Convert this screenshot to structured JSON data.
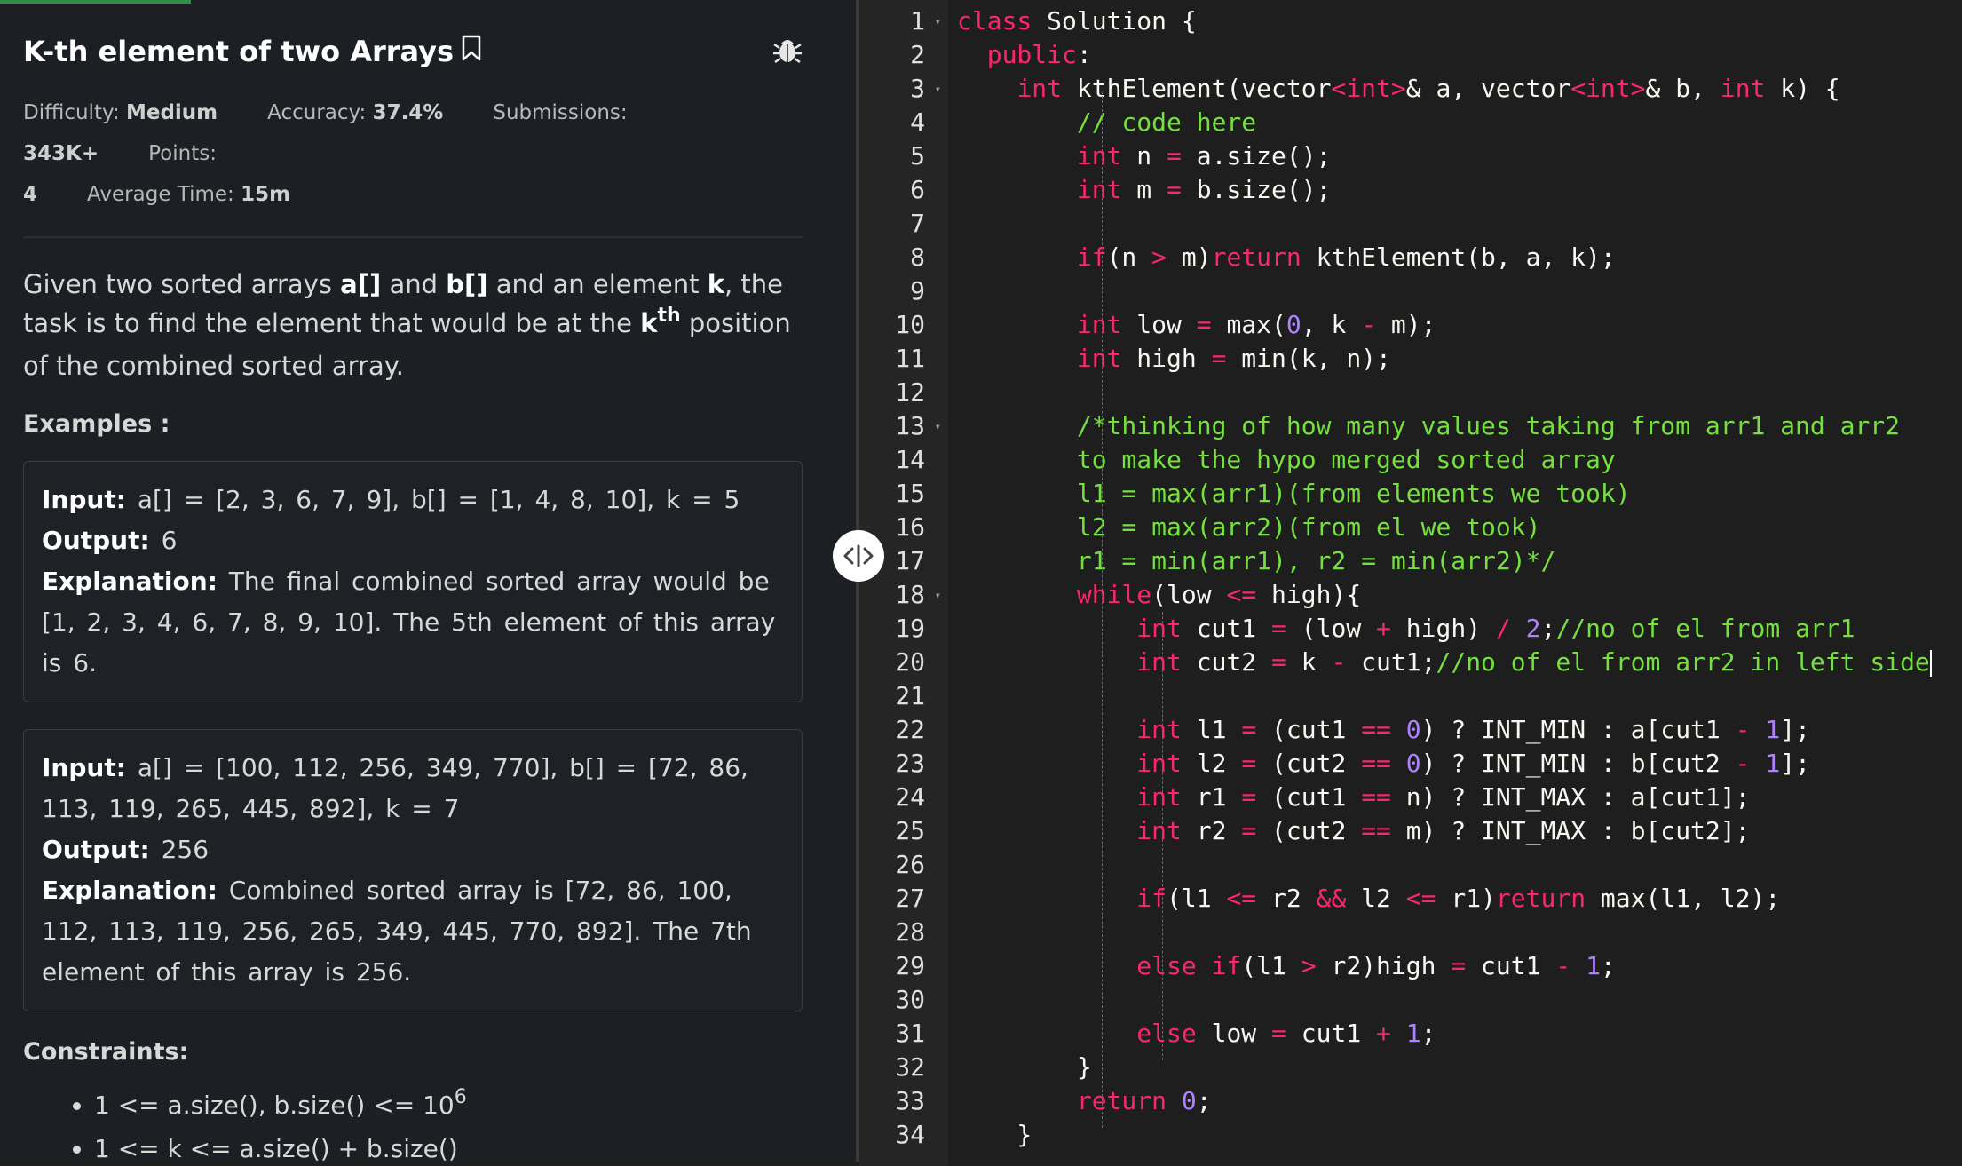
{
  "problem": {
    "title": "K-th element of two Arrays",
    "meta": {
      "difficulty_label": "Difficulty:",
      "difficulty": "Medium",
      "accuracy_label": "Accuracy:",
      "accuracy": "37.4%",
      "submissions_label": "Submissions:",
      "submissions": "343K+",
      "points_label": "Points:",
      "points": "4",
      "avg_time_label": "Average Time:",
      "avg_time": "15m"
    },
    "description": {
      "p1": "Given two sorted arrays ",
      "a": "a[]",
      "p2": " and ",
      "b": "b[]",
      "p3": " and an element ",
      "k": "k",
      "p4": ", the task is to find the element that would be at the ",
      "k2": "k",
      "sup": "th",
      "p5": " position of the combined sorted array."
    },
    "examples_heading": "Examples :",
    "examples": [
      {
        "input_label": "Input:",
        "input": "a[] = [2, 3, 6, 7, 9], b[] = [1, 4, 8, 10], k = 5",
        "output_label": "Output:",
        "output": "6",
        "explanation_label": "Explanation:",
        "explanation": "The final combined sorted array would be [1, 2, 3, 4, 6, 7, 8, 9, 10]. The 5th element of this array is 6."
      },
      {
        "input_label": "Input:",
        "input": "a[] = [100, 112, 256, 349, 770], b[] = [72, 86, 113, 119, 265, 445, 892], k = 7",
        "output_label": "Output:",
        "output": "256",
        "explanation_label": "Explanation:",
        "explanation": "Combined sorted array is [72, 86, 100, 112, 113, 119, 256, 265, 349, 445, 770, 892]. The 7th element of this array is 256."
      }
    ],
    "constraints_heading": "Constraints:",
    "constraints": [
      {
        "text": "1 <= a.size(), b.size() <= 10",
        "sup": "6"
      },
      {
        "text": "1 <= k <= a.size() + b.size()",
        "sup": ""
      }
    ]
  },
  "icons": {
    "bookmark": "bookmark-icon",
    "bug": "bug-icon",
    "splitter": "resize-handle-icon"
  },
  "colors": {
    "keyword": "#f92672",
    "number": "#ae81ff",
    "comment": "#75e03e",
    "progress": "#2f8d46"
  },
  "editor": {
    "fold_lines": [
      1,
      3,
      13,
      18
    ],
    "lines": [
      [
        [
          "k",
          "class"
        ],
        [
          "p",
          " Solution {"
        ]
      ],
      [
        [
          "p",
          "  "
        ],
        [
          "k",
          "public"
        ],
        [
          "p",
          ":"
        ]
      ],
      [
        [
          "p",
          "    "
        ],
        [
          "t",
          "int"
        ],
        [
          "p",
          " kthElement(vector"
        ],
        [
          "k",
          "<"
        ],
        [
          "t",
          "int"
        ],
        [
          "k",
          ">"
        ],
        [
          "p",
          "& a, vector"
        ],
        [
          "k",
          "<"
        ],
        [
          "t",
          "int"
        ],
        [
          "k",
          ">"
        ],
        [
          "p",
          "& b, "
        ],
        [
          "t",
          "int"
        ],
        [
          "p",
          " k) {"
        ]
      ],
      [
        [
          "p",
          "        "
        ],
        [
          "c",
          "// code here"
        ]
      ],
      [
        [
          "p",
          "        "
        ],
        [
          "t",
          "int"
        ],
        [
          "p",
          " n "
        ],
        [
          "k",
          "="
        ],
        [
          "p",
          " a.size();"
        ]
      ],
      [
        [
          "p",
          "        "
        ],
        [
          "t",
          "int"
        ],
        [
          "p",
          " m "
        ],
        [
          "k",
          "="
        ],
        [
          "p",
          " b.size();"
        ]
      ],
      [],
      [
        [
          "p",
          "        "
        ],
        [
          "k",
          "if"
        ],
        [
          "p",
          "(n "
        ],
        [
          "k",
          ">"
        ],
        [
          "p",
          " m)"
        ],
        [
          "k",
          "return"
        ],
        [
          "p",
          " kthElement(b, a, k);"
        ]
      ],
      [],
      [
        [
          "p",
          "        "
        ],
        [
          "t",
          "int"
        ],
        [
          "p",
          " low "
        ],
        [
          "k",
          "="
        ],
        [
          "p",
          " max("
        ],
        [
          "n",
          "0"
        ],
        [
          "p",
          ", k "
        ],
        [
          "k",
          "-"
        ],
        [
          "p",
          " m);"
        ]
      ],
      [
        [
          "p",
          "        "
        ],
        [
          "t",
          "int"
        ],
        [
          "p",
          " high "
        ],
        [
          "k",
          "="
        ],
        [
          "p",
          " min(k, n);"
        ]
      ],
      [],
      [
        [
          "p",
          "        "
        ],
        [
          "c",
          "/*thinking of how many values taking from arr1 and arr2"
        ]
      ],
      [
        [
          "p",
          "        "
        ],
        [
          "c",
          "to make the hypo merged sorted array"
        ]
      ],
      [
        [
          "p",
          "        "
        ],
        [
          "c",
          "l1 = max(arr1)(from elements we took)"
        ]
      ],
      [
        [
          "p",
          "        "
        ],
        [
          "c",
          "l2 = max(arr2)(from el we took)"
        ]
      ],
      [
        [
          "p",
          "        "
        ],
        [
          "c",
          "r1 = min(arr1), r2 = min(arr2)*/"
        ]
      ],
      [
        [
          "p",
          "        "
        ],
        [
          "k",
          "while"
        ],
        [
          "p",
          "(low "
        ],
        [
          "k",
          "<="
        ],
        [
          "p",
          " high){"
        ]
      ],
      [
        [
          "p",
          "            "
        ],
        [
          "t",
          "int"
        ],
        [
          "p",
          " cut1 "
        ],
        [
          "k",
          "="
        ],
        [
          "p",
          " (low "
        ],
        [
          "k",
          "+"
        ],
        [
          "p",
          " high) "
        ],
        [
          "k",
          "/"
        ],
        [
          "p",
          " "
        ],
        [
          "n",
          "2"
        ],
        [
          "p",
          ";"
        ],
        [
          "c",
          "//no of el from arr1"
        ]
      ],
      [
        [
          "p",
          "            "
        ],
        [
          "t",
          "int"
        ],
        [
          "p",
          " cut2 "
        ],
        [
          "k",
          "="
        ],
        [
          "p",
          " k "
        ],
        [
          "k",
          "-"
        ],
        [
          "p",
          " cut1;"
        ],
        [
          "c",
          "//no of el from arr2 in left side"
        ]
      ],
      [],
      [
        [
          "p",
          "            "
        ],
        [
          "t",
          "int"
        ],
        [
          "p",
          " l1 "
        ],
        [
          "k",
          "="
        ],
        [
          "p",
          " (cut1 "
        ],
        [
          "k",
          "=="
        ],
        [
          "p",
          " "
        ],
        [
          "n",
          "0"
        ],
        [
          "p",
          ") ? INT_MIN : a[cut1 "
        ],
        [
          "k",
          "-"
        ],
        [
          "p",
          " "
        ],
        [
          "n",
          "1"
        ],
        [
          "p",
          "];"
        ]
      ],
      [
        [
          "p",
          "            "
        ],
        [
          "t",
          "int"
        ],
        [
          "p",
          " l2 "
        ],
        [
          "k",
          "="
        ],
        [
          "p",
          " (cut2 "
        ],
        [
          "k",
          "=="
        ],
        [
          "p",
          " "
        ],
        [
          "n",
          "0"
        ],
        [
          "p",
          ") ? INT_MIN : b[cut2 "
        ],
        [
          "k",
          "-"
        ],
        [
          "p",
          " "
        ],
        [
          "n",
          "1"
        ],
        [
          "p",
          "];"
        ]
      ],
      [
        [
          "p",
          "            "
        ],
        [
          "t",
          "int"
        ],
        [
          "p",
          " r1 "
        ],
        [
          "k",
          "="
        ],
        [
          "p",
          " (cut1 "
        ],
        [
          "k",
          "=="
        ],
        [
          "p",
          " n) ? INT_MAX : a[cut1];"
        ]
      ],
      [
        [
          "p",
          "            "
        ],
        [
          "t",
          "int"
        ],
        [
          "p",
          " r2 "
        ],
        [
          "k",
          "="
        ],
        [
          "p",
          " (cut2 "
        ],
        [
          "k",
          "=="
        ],
        [
          "p",
          " m) ? INT_MAX : b[cut2];"
        ]
      ],
      [],
      [
        [
          "p",
          "            "
        ],
        [
          "k",
          "if"
        ],
        [
          "p",
          "(l1 "
        ],
        [
          "k",
          "<="
        ],
        [
          "p",
          " r2 "
        ],
        [
          "k",
          "&&"
        ],
        [
          "p",
          " l2 "
        ],
        [
          "k",
          "<="
        ],
        [
          "p",
          " r1)"
        ],
        [
          "k",
          "return"
        ],
        [
          "p",
          " max(l1, l2);"
        ]
      ],
      [],
      [
        [
          "p",
          "            "
        ],
        [
          "k",
          "else"
        ],
        [
          "p",
          " "
        ],
        [
          "k",
          "if"
        ],
        [
          "p",
          "(l1 "
        ],
        [
          "k",
          ">"
        ],
        [
          "p",
          " r2)high "
        ],
        [
          "k",
          "="
        ],
        [
          "p",
          " cut1 "
        ],
        [
          "k",
          "-"
        ],
        [
          "p",
          " "
        ],
        [
          "n",
          "1"
        ],
        [
          "p",
          ";"
        ]
      ],
      [],
      [
        [
          "p",
          "            "
        ],
        [
          "k",
          "else"
        ],
        [
          "p",
          " low "
        ],
        [
          "k",
          "="
        ],
        [
          "p",
          " cut1 "
        ],
        [
          "k",
          "+"
        ],
        [
          "p",
          " "
        ],
        [
          "n",
          "1"
        ],
        [
          "p",
          ";"
        ]
      ],
      [
        [
          "p",
          "        }"
        ]
      ],
      [
        [
          "p",
          "        "
        ],
        [
          "k",
          "return"
        ],
        [
          "p",
          " "
        ],
        [
          "n",
          "0"
        ],
        [
          "p",
          ";"
        ]
      ],
      [
        [
          "p",
          "    }"
        ]
      ]
    ]
  }
}
